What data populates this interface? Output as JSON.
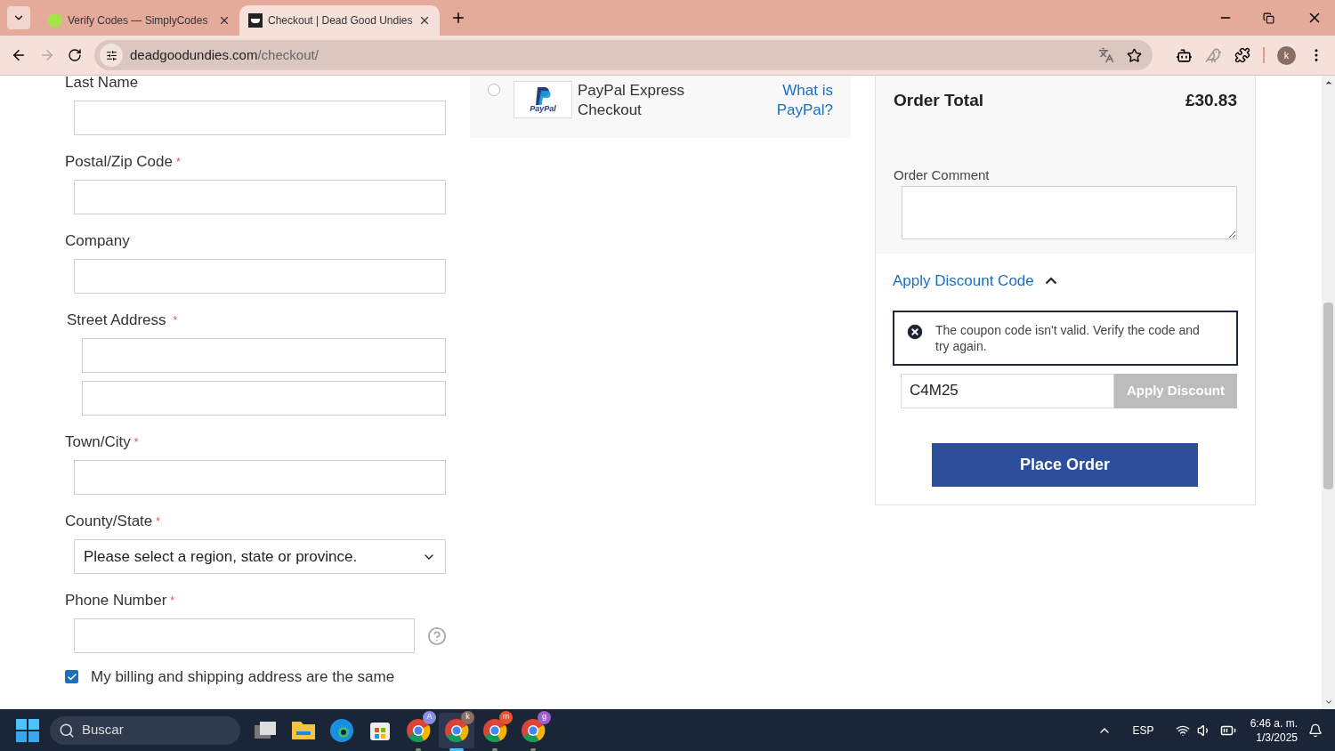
{
  "browser": {
    "tabs": [
      {
        "title": "Verify Codes — SimplyCodes",
        "selected": false
      },
      {
        "title": "Checkout | Dead Good Undies",
        "selected": true
      }
    ],
    "url": {
      "domain": "deadgoodundies.com",
      "path": "/checkout/"
    },
    "profile_initial": "k"
  },
  "form": {
    "required_mark": "*",
    "fields": [
      {
        "label": "Last Name",
        "required": false,
        "kind": "input"
      },
      {
        "label": "Postal/Zip Code",
        "required": true,
        "kind": "input"
      },
      {
        "label": "Company",
        "required": false,
        "kind": "input"
      },
      {
        "label": "Street Address",
        "required": true,
        "kind": "pair"
      },
      {
        "label": "Town/City",
        "required": true,
        "kind": "input"
      },
      {
        "label": "County/State",
        "required": true,
        "kind": "select",
        "value": "Please select a region, state or province."
      },
      {
        "label": "Phone Number",
        "required": true,
        "kind": "phone"
      }
    ],
    "billing_same": {
      "label": "My billing and shipping address are the same",
      "checked": true
    }
  },
  "payment": {
    "option": {
      "label": "PayPal Express Checkout",
      "selected": false,
      "logo_text": "PayPal"
    },
    "link": "What is PayPal?"
  },
  "summary": {
    "order_total": {
      "label": "Order Total",
      "value": "£30.83"
    },
    "order_comment": {
      "label": "Order Comment"
    },
    "discount": {
      "toggle": "Apply Discount Code",
      "expanded": true,
      "error": "The coupon code isn't valid. Verify the code and try again.",
      "code": "C4M25",
      "button": {
        "label": "Apply Discount",
        "disabled": true
      }
    },
    "place_order": "Place Order"
  },
  "taskbar": {
    "search_placeholder": "Buscar",
    "chrome_profiles": [
      {
        "badge": "A",
        "color": "#8a8fe0",
        "selected": false
      },
      {
        "badge": "k",
        "color": "#8a6d63",
        "selected": true
      },
      {
        "badge": "m",
        "color": "#e8532f",
        "selected": false
      },
      {
        "badge": "g",
        "color": "#9b5fd0",
        "selected": false
      }
    ],
    "language": "ESP",
    "time": "6:46 a. m.",
    "date": "1/3/2025"
  }
}
